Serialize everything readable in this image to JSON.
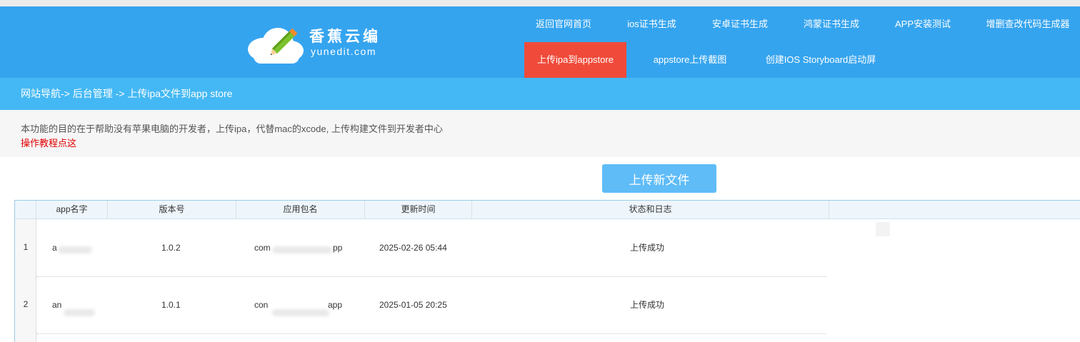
{
  "logo": {
    "name_cn": "香蕉云编",
    "domain": "yunedit.com"
  },
  "nav": [
    {
      "label": "返回官网首页",
      "active": false
    },
    {
      "label": "ios证书生成",
      "active": false
    },
    {
      "label": "安卓证书生成",
      "active": false
    },
    {
      "label": "鸿蒙证书生成",
      "active": false
    },
    {
      "label": "APP安装测试",
      "active": false
    },
    {
      "label": "增删查改代码生成器",
      "active": false
    },
    {
      "label": "上传ipa到appstore",
      "active": true
    },
    {
      "label": "appstore上传截图",
      "active": false
    },
    {
      "label": "创建IOS Storyboard启动屏",
      "active": false
    }
  ],
  "breadcrumb": "网站导航-> 后台管理 -> 上传ipa文件到app store",
  "description": "本功能的目的在于帮助没有苹果电脑的开发者，上传ipa，代替mac的xcode, 上传构建文件到开发者中心",
  "tutorial_link": "操作教程点这",
  "upload_button": "上传新文件",
  "table": {
    "columns": [
      "app名字",
      "版本号",
      "应用包名",
      "更新时间",
      "状态和日志"
    ],
    "rows": [
      {
        "num": "1",
        "app_name": "a",
        "version": "1.0.2",
        "package_prefix": "com",
        "package_suffix": "pp",
        "updated": "2025-02-26 05:44",
        "status": "上传成功"
      },
      {
        "num": "2",
        "app_name": "an",
        "version": "1.0.1",
        "package_prefix": "con",
        "package_suffix": "app",
        "updated": "2025-01-05 20:25",
        "status": "上传成功"
      }
    ]
  },
  "colors": {
    "header": "#35a4ef",
    "breadcrumb": "#44b8f4",
    "active_nav": "#f04b3a",
    "button": "#5fbcf7",
    "tutorial": "#e00000"
  }
}
